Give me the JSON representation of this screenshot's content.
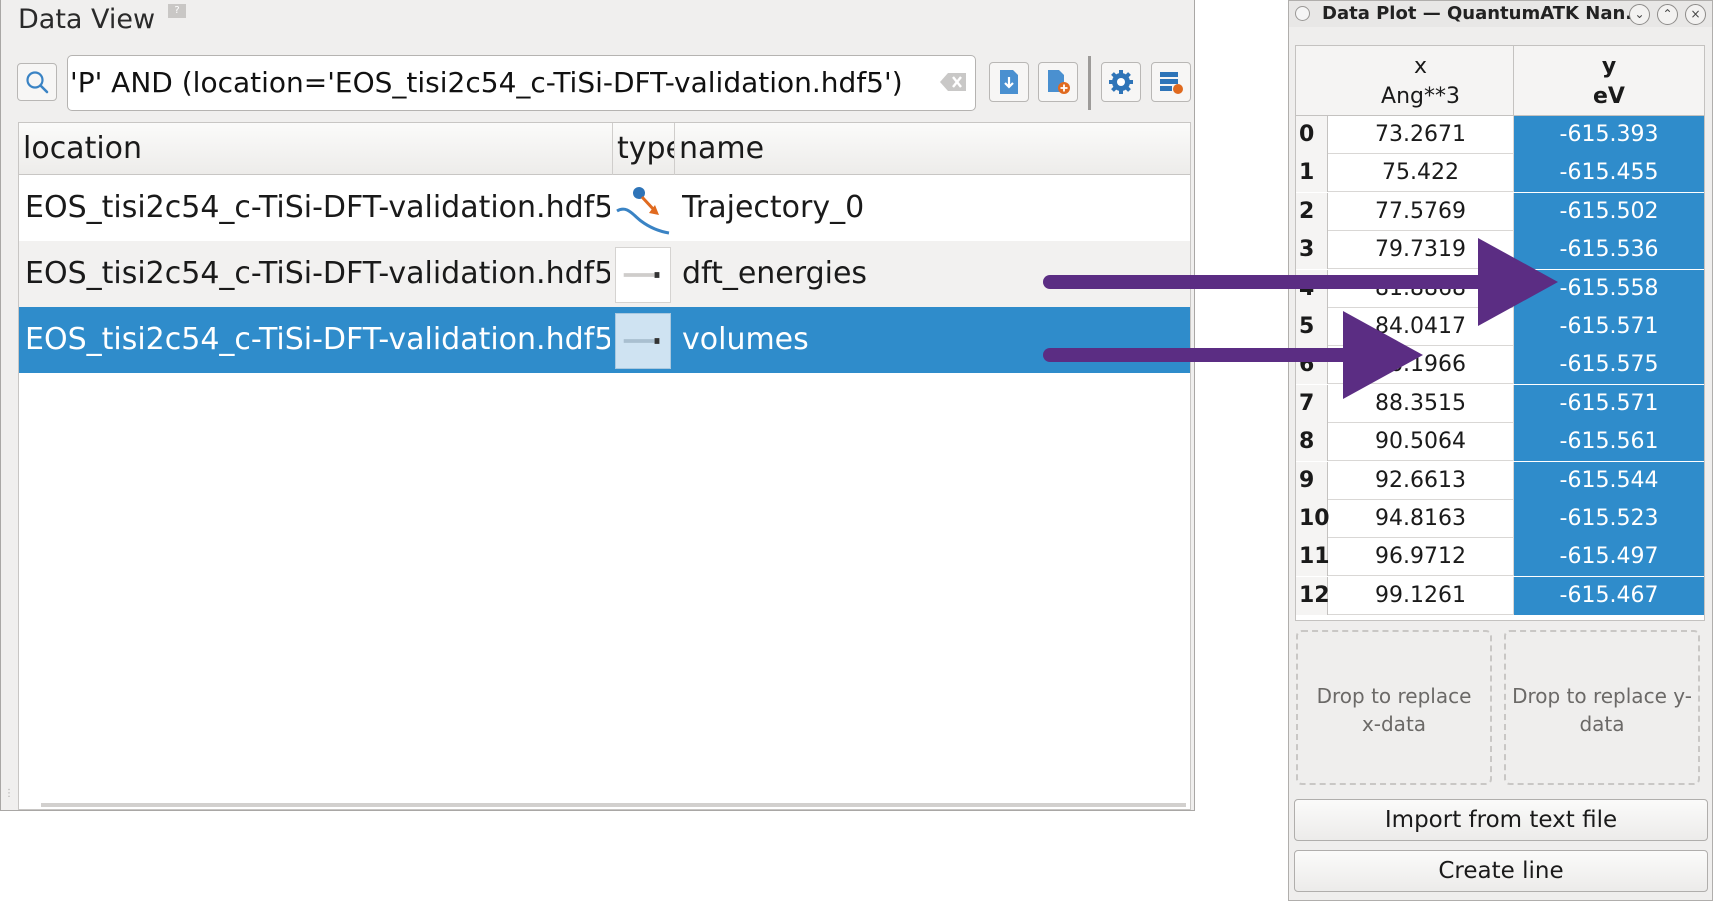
{
  "data_view": {
    "title": "Data View",
    "search_value": "'P' AND (location='EOS_tisi2c54_c-TiSi-DFT-validation.hdf5')",
    "columns": [
      "location",
      "type",
      "name"
    ],
    "rows": [
      {
        "location": "EOS_tisi2c54_c-TiSi-DFT-validation.hdf5",
        "type_icon": "trajectory-icon",
        "name": "Trajectory_0",
        "selected": false
      },
      {
        "location": "EOS_tisi2c54_c-TiSi-DFT-validation.hdf5",
        "type_icon": "array-icon",
        "name": "dft_energies",
        "selected": false
      },
      {
        "location": "EOS_tisi2c54_c-TiSi-DFT-validation.hdf5",
        "type_icon": "array-icon",
        "name": "volumes",
        "selected": true
      }
    ],
    "toolbar_icons": [
      "import-icon",
      "new-file-icon",
      "settings-icon",
      "columns-icon"
    ]
  },
  "data_plot": {
    "window_title": "Data Plot — QuantumATK Nan...",
    "x_header": {
      "name": "x",
      "unit": "Ang**3"
    },
    "y_header": {
      "name": "y",
      "unit": "eV"
    },
    "rows": [
      {
        "i": "0",
        "x": "73.2671",
        "y": "-615.393"
      },
      {
        "i": "1",
        "x": "75.422",
        "y": "-615.455"
      },
      {
        "i": "2",
        "x": "77.5769",
        "y": "-615.502"
      },
      {
        "i": "3",
        "x": "79.7319",
        "y": "-615.536"
      },
      {
        "i": "4",
        "x": "81.8868",
        "y": "-615.558"
      },
      {
        "i": "5",
        "x": "84.0417",
        "y": "-615.571"
      },
      {
        "i": "6",
        "x": "86.1966",
        "y": "-615.575"
      },
      {
        "i": "7",
        "x": "88.3515",
        "y": "-615.571"
      },
      {
        "i": "8",
        "x": "90.5064",
        "y": "-615.561"
      },
      {
        "i": "9",
        "x": "92.6613",
        "y": "-615.544"
      },
      {
        "i": "10",
        "x": "94.8163",
        "y": "-615.523"
      },
      {
        "i": "11",
        "x": "96.9712",
        "y": "-615.497"
      },
      {
        "i": "12",
        "x": "99.1261",
        "y": "-615.467"
      }
    ],
    "drop_x_label": "Drop to replace x-data",
    "drop_y_label": "Drop to replace y-data",
    "import_button": "Import from text file",
    "create_button": "Create line"
  },
  "colors": {
    "selection": "#2f8ccb",
    "arrow": "#5b2d83"
  }
}
